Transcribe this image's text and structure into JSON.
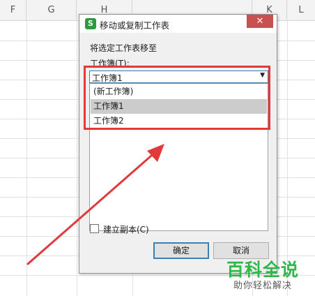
{
  "spreadsheet": {
    "columns": [
      "F",
      "G",
      "H",
      "K",
      "L"
    ]
  },
  "dialog": {
    "title": "移动或复制工作表",
    "app_icon": "S",
    "close_glyph": "✕",
    "move_label": "将选定工作表移至",
    "workbook_label": "工作簿(T):",
    "workbook_selected": "工作簿1",
    "dropdown_options": [
      "(新工作簿)",
      "工作簿1",
      "工作簿2"
    ],
    "dropdown_highlighted": "工作簿1",
    "create_copy_label": "建立副本(C)",
    "create_copy_checked": false,
    "ok_label": "确定",
    "cancel_label": "取消"
  },
  "annotation": {
    "highlight_color": "#e23a3a"
  },
  "watermark": {
    "title": "百科全说",
    "subtitle": "助你轻松解决"
  },
  "colors": {
    "accent": "#3c7fb1",
    "close": "#c75050",
    "wps_green": "#2e9a40",
    "watermark_green": "#2fb84a"
  }
}
